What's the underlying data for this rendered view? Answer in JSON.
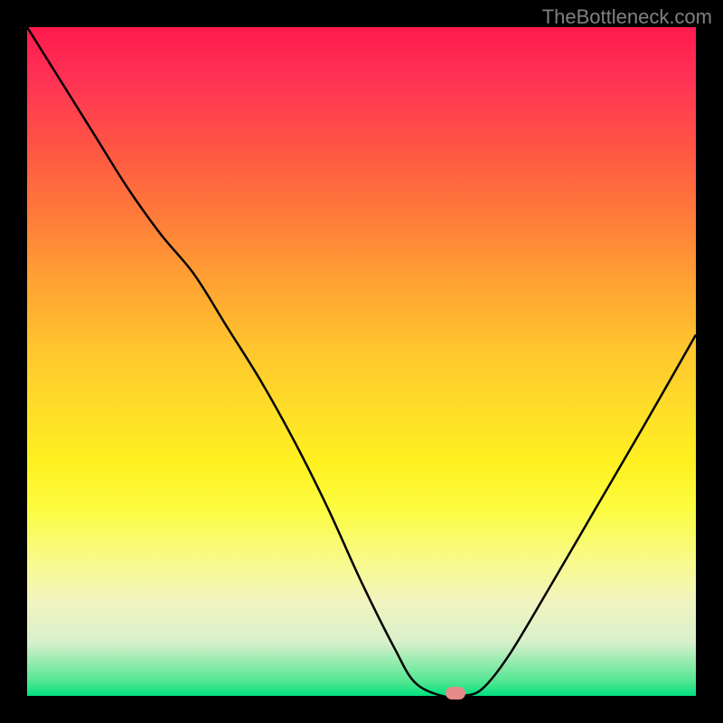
{
  "watermark": "TheBottleneck.com",
  "chart_data": {
    "type": "line",
    "title": "",
    "xlabel": "",
    "ylabel": "",
    "xlim": [
      0,
      100
    ],
    "ylim": [
      0,
      100
    ],
    "x": [
      0,
      5,
      10,
      15,
      20,
      25,
      30,
      35,
      40,
      45,
      50,
      55,
      58,
      62,
      65,
      68,
      72,
      78,
      85,
      92,
      100
    ],
    "values": [
      100,
      92,
      84,
      76,
      69,
      63,
      55,
      47,
      38,
      28,
      17,
      7,
      2,
      0,
      0,
      1,
      6,
      16,
      28,
      40,
      54
    ],
    "marker": {
      "x": 64,
      "y": 0
    },
    "gradient_stops": [
      {
        "pos": 0,
        "color": "#ff1a4d"
      },
      {
        "pos": 50,
        "color": "#ffd52e"
      },
      {
        "pos": 80,
        "color": "#fcfc80"
      },
      {
        "pos": 100,
        "color": "#00e080"
      }
    ]
  }
}
